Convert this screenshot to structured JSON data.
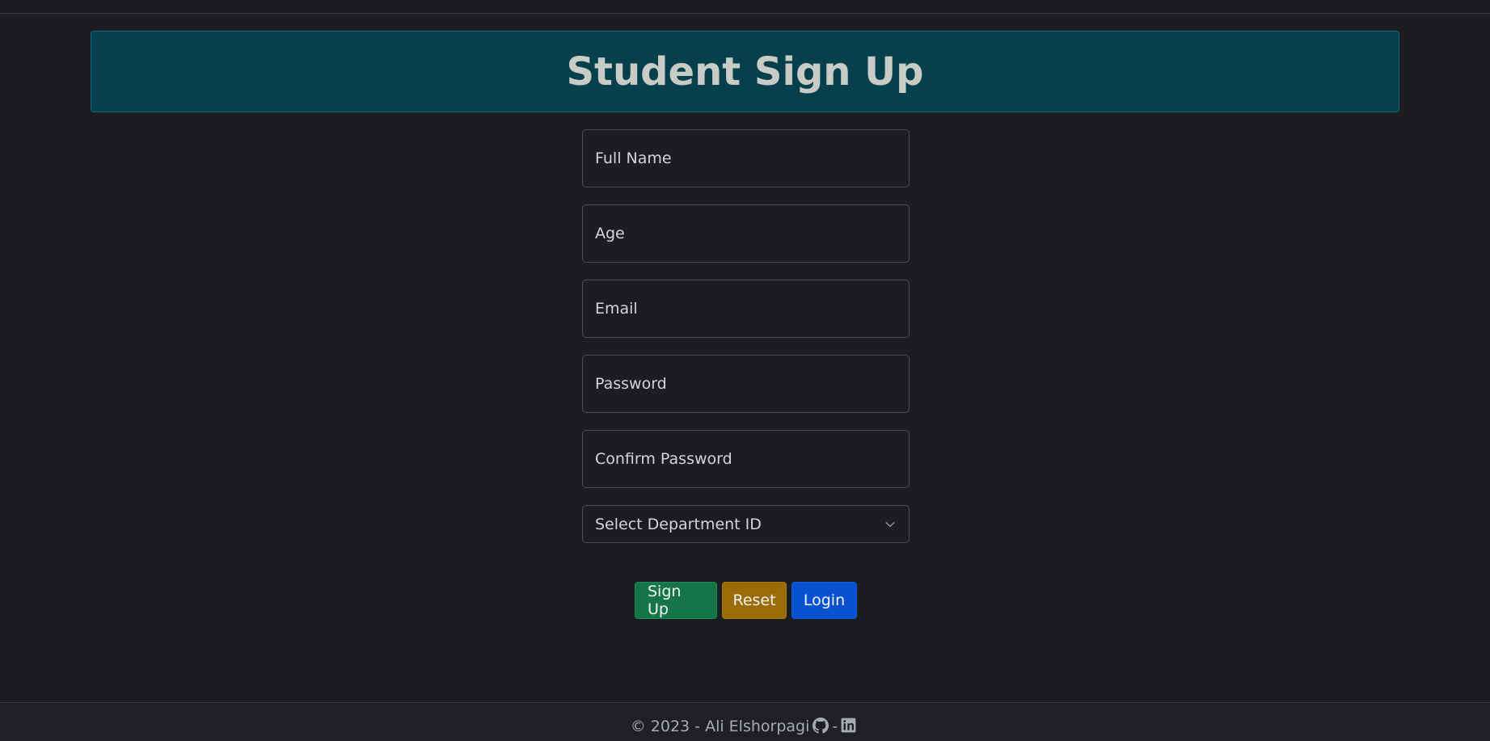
{
  "header": {
    "title": "Student Sign Up"
  },
  "form": {
    "full_name_placeholder": "Full Name",
    "age_placeholder": "Age",
    "email_placeholder": "Email",
    "password_placeholder": "Password",
    "confirm_password_placeholder": "Confirm Password",
    "department_select": "Select Department ID"
  },
  "buttons": {
    "signup_label": "Sign Up",
    "reset_label": "Reset",
    "login_label": "Login"
  },
  "footer": {
    "text": "© 2023 - Ali Elshorpagi",
    "separator": "-",
    "github_icon": "github-icon",
    "linkedin_icon": "linkedin-icon"
  },
  "colors": {
    "background": "#1b1d20",
    "header_bg": "#06404d",
    "signup": "#167548",
    "reset": "#9a6b06",
    "login": "#0851cf"
  }
}
